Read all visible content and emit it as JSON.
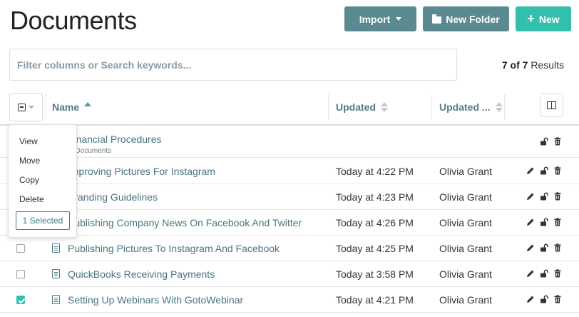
{
  "page": {
    "title": "Documents"
  },
  "toolbar": {
    "import_label": "Import",
    "new_folder_label": "New Folder",
    "new_label": "New"
  },
  "search": {
    "placeholder": "Filter columns or Search keywords...",
    "value": ""
  },
  "results": {
    "shown": "7",
    "of_word": "of",
    "total": "7",
    "suffix": "Results"
  },
  "columns": {
    "name": "Name",
    "updated": "Updated",
    "updated_by": "Updated ..."
  },
  "colors": {
    "accent": "#5a8a90",
    "primary": "#33bfab",
    "link": "#4a7580"
  },
  "rows": [
    {
      "name": "Financial Procedures",
      "subtitle": "in Documents",
      "updated": "",
      "updated_by": "",
      "checked": false,
      "type": "folder"
    },
    {
      "name": "Improving Pictures For Instagram",
      "updated": "Today at 4:22 PM",
      "updated_by": "Olivia Grant",
      "checked": false,
      "type": "document"
    },
    {
      "name": "Branding Guidelines",
      "updated": "Today at 4:23 PM",
      "updated_by": "Olivia Grant",
      "checked": false,
      "type": "document"
    },
    {
      "name": "Publishing Company News On Facebook And Twitter",
      "updated": "Today at 4:26 PM",
      "updated_by": "Olivia Grant",
      "checked": false,
      "type": "document"
    },
    {
      "name": "Publishing Pictures To Instagram And Facebook",
      "updated": "Today at 4:25 PM",
      "updated_by": "Olivia Grant",
      "checked": false,
      "type": "document"
    },
    {
      "name": "QuickBooks Receiving Payments",
      "updated": "Today at 3:58 PM",
      "updated_by": "Olivia Grant",
      "checked": false,
      "type": "document"
    },
    {
      "name": "Setting Up Webinars With GotoWebinar",
      "updated": "Today at 4:21 PM",
      "updated_by": "Olivia Grant",
      "checked": true,
      "type": "document"
    }
  ],
  "bulk_menu": {
    "items": [
      "View",
      "Move",
      "Copy",
      "Delete"
    ],
    "selected_label": "1 Selected"
  },
  "icons": {
    "edit": "pencil-icon",
    "lock": "unlock-icon",
    "delete": "trash-icon",
    "doc": "document-icon",
    "columns": "columns-icon"
  }
}
